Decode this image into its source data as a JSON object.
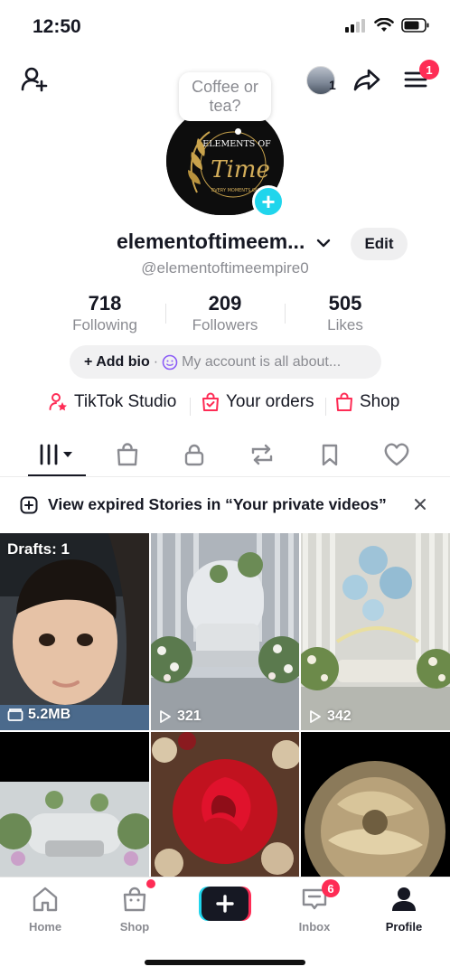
{
  "status_bar": {
    "time": "12:50"
  },
  "header": {
    "bubble_text": "Coffee or tea?",
    "mini_avatar_count": "1",
    "menu_badge": "1"
  },
  "profile": {
    "display_name": "elementoftimeem...",
    "handle": "@elementoftimeempire0",
    "edit_label": "Edit",
    "avatar_logo_top": "ELEMENTS OF",
    "avatar_logo_main": "Time",
    "avatar_logo_tagline": "EVERY MOMENTS OUR"
  },
  "stats": {
    "following": {
      "value": "718",
      "label": "Following"
    },
    "followers": {
      "value": "209",
      "label": "Followers"
    },
    "likes": {
      "value": "505",
      "label": "Likes"
    }
  },
  "bio": {
    "add_label": "+ Add bio",
    "placeholder": "My account is all about..."
  },
  "links": {
    "studio": "TikTok Studio",
    "orders": "Your orders",
    "shop": "Shop"
  },
  "tabs": [
    "videos-grid",
    "shop",
    "private",
    "reposts",
    "favorites",
    "liked"
  ],
  "banner": {
    "text": "View expired Stories in “Your private videos”"
  },
  "grid": {
    "drafts_label": "Drafts: 1",
    "drafts_size": "5.2MB",
    "video_1_views": "321",
    "video_2_views": "342"
  },
  "nav": {
    "home": "Home",
    "shop": "Shop",
    "inbox": "Inbox",
    "inbox_badge": "6",
    "profile": "Profile"
  },
  "colors": {
    "accent_red": "#fe2c55",
    "accent_cyan": "#20d5ec",
    "text_primary": "#161823",
    "text_secondary": "#8a8b91"
  }
}
